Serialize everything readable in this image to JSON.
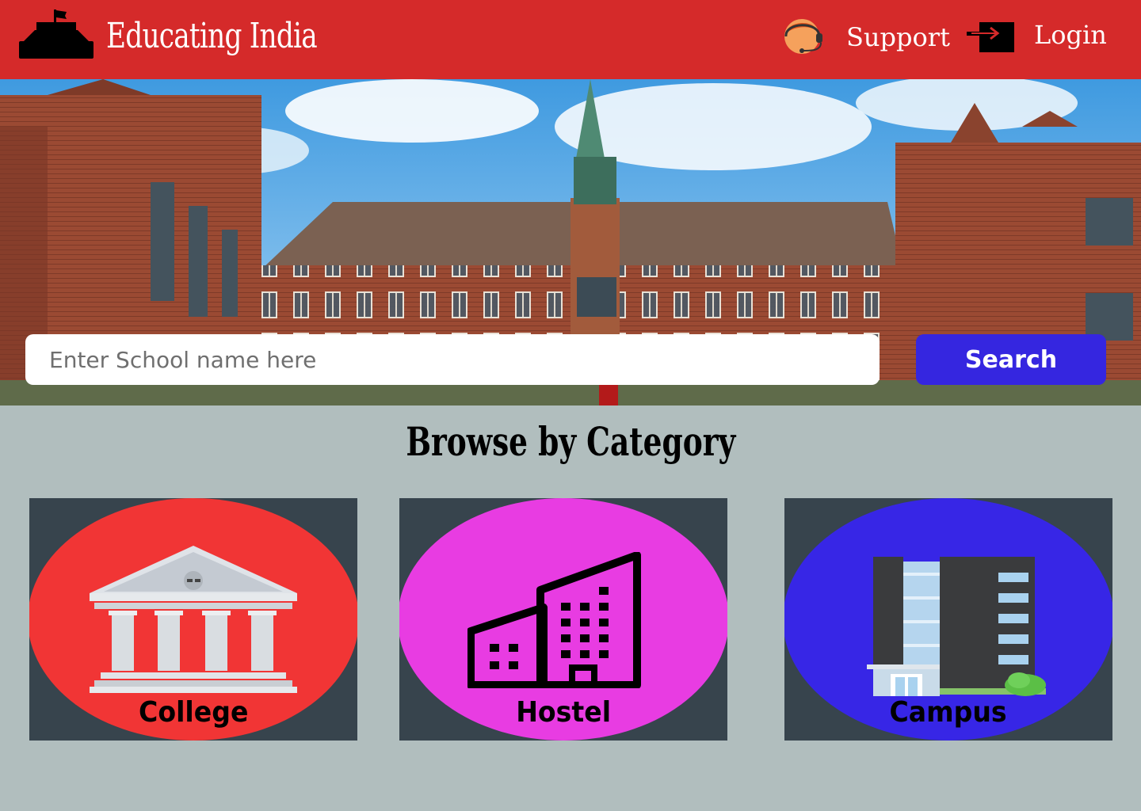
{
  "header": {
    "brand": "Educating India",
    "support_label": "Support",
    "login_label": "Login",
    "background_color": "#d52a2a"
  },
  "search": {
    "placeholder": "Enter School name here",
    "value": "",
    "button_label": "Search",
    "button_color": "#3526e0"
  },
  "categories": {
    "title": "Browse by Category",
    "items": [
      {
        "label": "College",
        "color": "#f13535",
        "icon": "college-building-icon"
      },
      {
        "label": "Hostel",
        "color": "#e83ce2",
        "icon": "hostel-building-icon"
      },
      {
        "label": "Campus",
        "color": "#3726e6",
        "icon": "campus-building-icon"
      }
    ]
  },
  "page_background": "#b1bebe",
  "card_background": "#37444d"
}
